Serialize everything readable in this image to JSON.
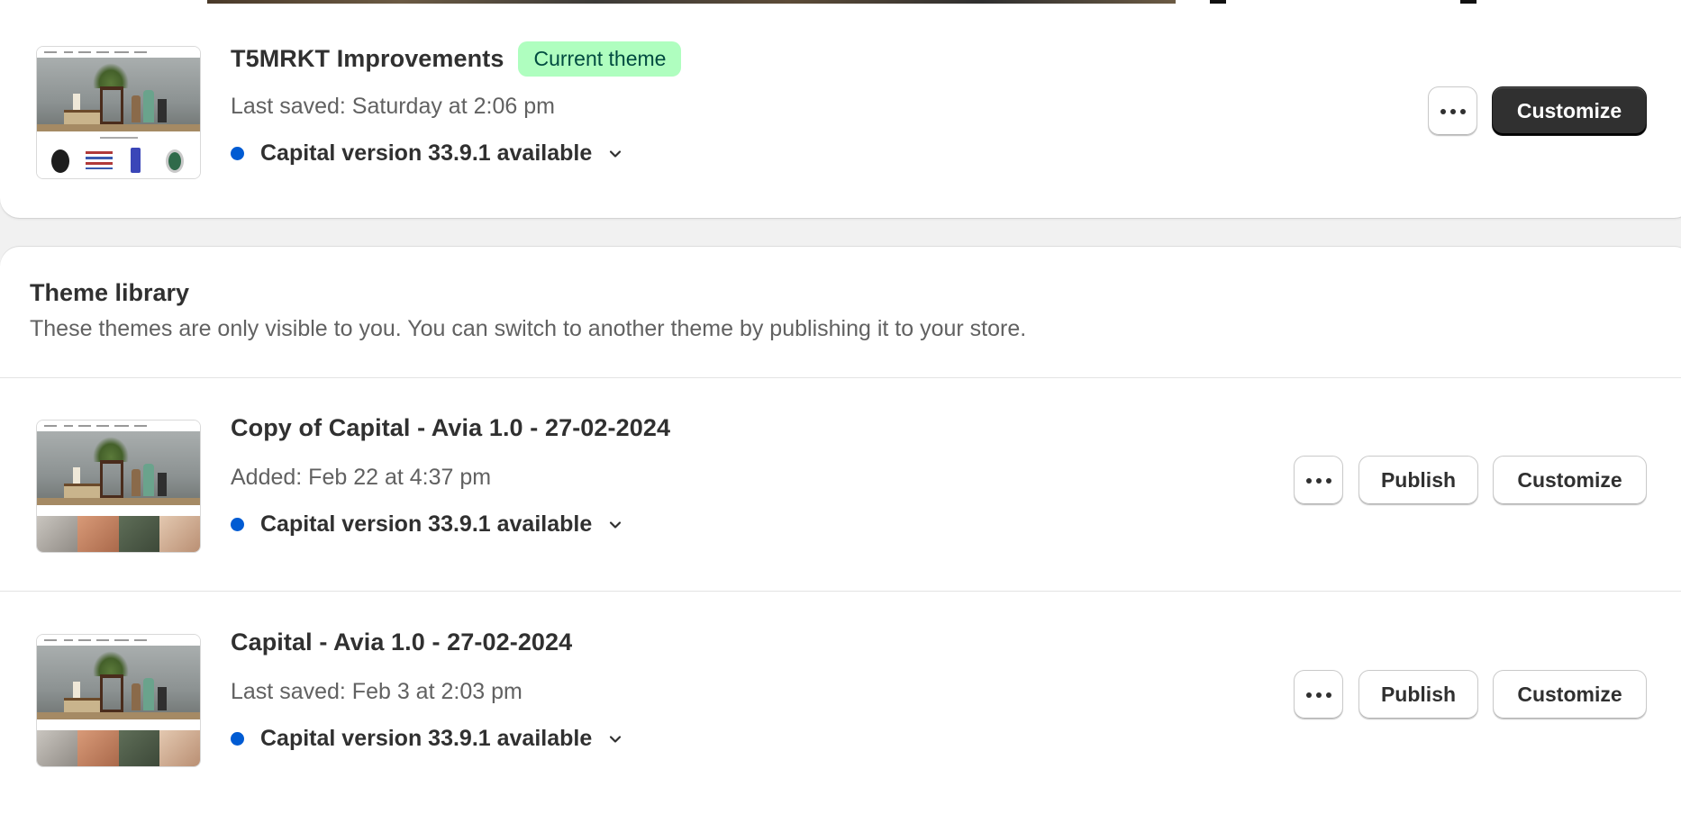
{
  "current_theme": {
    "name": "T5MRKT Improvements",
    "badge": "Current theme",
    "meta": "Last saved: Saturday at 2:06 pm",
    "version": "Capital version 33.9.1 available",
    "customize_label": "Customize"
  },
  "library": {
    "title": "Theme library",
    "description": "These themes are only visible to you. You can switch to another theme by publishing it to your store.",
    "themes": [
      {
        "name": "Copy of Capital - Avia 1.0 - 27-02-2024",
        "meta": "Added: Feb 22 at 4:37 pm",
        "version": "Capital version 33.9.1 available",
        "publish_label": "Publish",
        "customize_label": "Customize"
      },
      {
        "name": "Capital - Avia 1.0 - 27-02-2024",
        "meta": "Last saved: Feb 3 at 2:03 pm",
        "version": "Capital version 33.9.1 available",
        "publish_label": "Publish",
        "customize_label": "Customize"
      }
    ]
  },
  "icons": {
    "more": "more-actions-icon",
    "chevron": "chevron-down-icon",
    "status_dot": "info-dot-icon"
  },
  "colors": {
    "badge_bg": "#affebf",
    "badge_text": "#014b40",
    "status_dot": "#005bd3",
    "primary_button": "#303030"
  }
}
